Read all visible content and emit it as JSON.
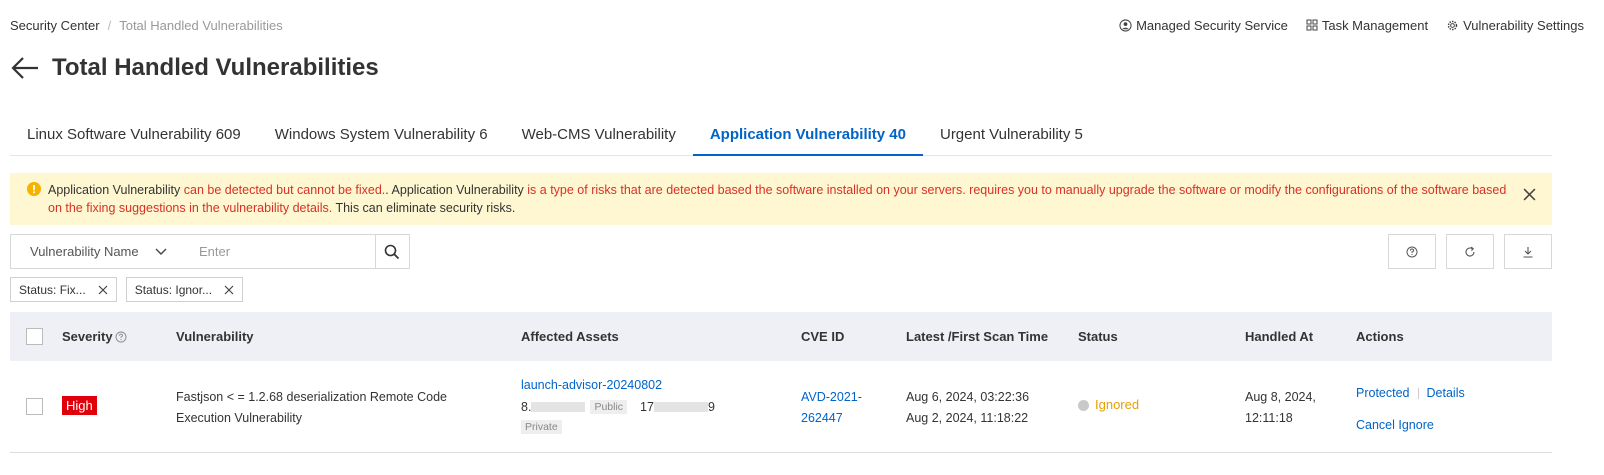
{
  "breadcrumb": {
    "root": "Security Center",
    "sep": "/",
    "current": "Total Handled Vulnerabilities"
  },
  "top_links": [
    {
      "label": "Managed Security Service",
      "icon": "user-circle-icon"
    },
    {
      "label": "Task Management",
      "icon": "grid-icon"
    },
    {
      "label": "Vulnerability Settings",
      "icon": "gear-icon"
    }
  ],
  "page": {
    "title": "Total Handled Vulnerabilities"
  },
  "tabs": [
    {
      "label": "Linux Software Vulnerability 609",
      "active": false
    },
    {
      "label": "Windows System Vulnerability 6",
      "active": false
    },
    {
      "label": "Web-CMS Vulnerability",
      "active": false
    },
    {
      "label": "Application Vulnerability 40",
      "active": true
    },
    {
      "label": "Urgent Vulnerability 5",
      "active": false
    }
  ],
  "alert": {
    "p1": "Application Vulnerability",
    "p2": " can be detected but cannot be fixed.",
    "p3": ". Application Vulnerability",
    "p4": " is a type of risks that are detected based the software installed on your servers.",
    "p5": " requires you to manually upgrade the software or modify the configurations of the software based on the fixing suggestions in the vulnerability details.",
    "p6": " This can eliminate security risks."
  },
  "filter": {
    "field": "Vulnerability Name",
    "placeholder": "Enter"
  },
  "chips": [
    {
      "label": "Status: Fix..."
    },
    {
      "label": "Status: Ignor..."
    }
  ],
  "table": {
    "headers": {
      "severity": "Severity",
      "vulnerability": "Vulnerability",
      "assets": "Affected Assets",
      "cve": "CVE ID",
      "scan_time": "Latest /First Scan Time",
      "status": "Status",
      "handled_at": "Handled At",
      "actions": "Actions"
    },
    "rows": [
      {
        "severity": "High",
        "vuln_line1": "Fastjson < = 1.2.68 deserialization Remote Code",
        "vuln_line2": "Execution Vulnerability",
        "asset_name": "launch-advisor-20240802",
        "ip_public_prefix": "8.",
        "public_tag": "Public",
        "ip_private_prefix": "17",
        "ip_private_suffix": "9",
        "private_tag": "Private",
        "cve_line1": "AVD-2021-",
        "cve_line2": "262447",
        "latest_scan": "Aug 6, 2024, 03:22:36",
        "first_scan": "Aug 2, 2024, 11:18:22",
        "status": "Ignored",
        "handled_line1": "Aug 8, 2024,",
        "handled_line2": "12:11:18",
        "action_protected": "Protected",
        "action_details": "Details",
        "action_cancel": "Cancel Ignore"
      }
    ]
  },
  "colors": {
    "accent": "#0064c8",
    "danger": "#e0000a",
    "warning": "#e6a100",
    "alert_bg": "#fff7d1",
    "alert_text": "#d93026"
  }
}
